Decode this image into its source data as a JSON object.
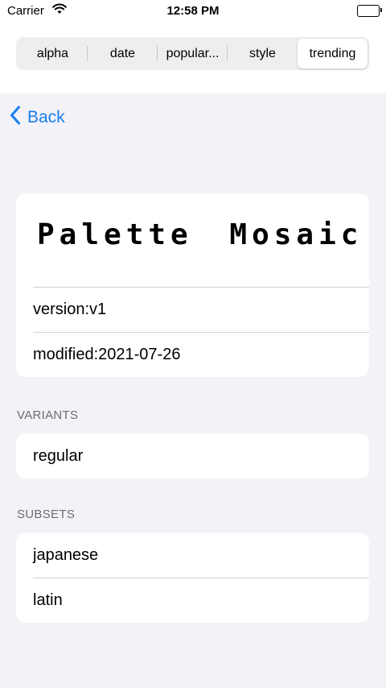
{
  "status": {
    "carrier": "Carrier",
    "time": "12:58 PM"
  },
  "sort_tabs": {
    "items": [
      {
        "label": "alpha",
        "selected": false
      },
      {
        "label": "date",
        "selected": false
      },
      {
        "label": "popular...",
        "selected": false
      },
      {
        "label": "style",
        "selected": false
      },
      {
        "label": "trending",
        "selected": true
      }
    ]
  },
  "nav": {
    "back_label": "Back"
  },
  "font": {
    "name": "Palette Mosaic",
    "version": "version:v1",
    "modified": "modified:2021-07-26"
  },
  "variants": {
    "header": "VARIANTS",
    "items": [
      "regular"
    ]
  },
  "subsets": {
    "header": "SUBSETS",
    "items": [
      "japanese",
      "latin"
    ]
  },
  "colors": {
    "accent": "#1a7ef0",
    "background": "#f2f2f7"
  }
}
